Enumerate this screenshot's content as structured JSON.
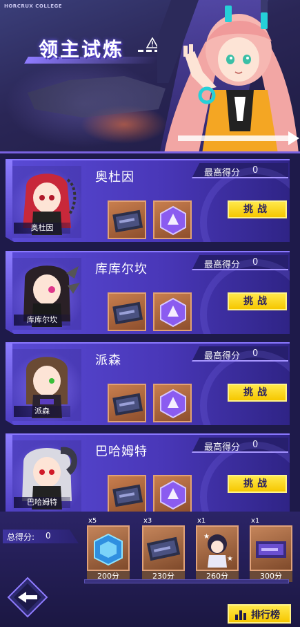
{
  "header": {
    "brand": "HORCRUX COLLEGE",
    "title": "领主试炼"
  },
  "labels": {
    "best_score": "最高得分",
    "challenge": "挑战"
  },
  "bosses": [
    {
      "name": "奥杜因",
      "portrait_tag": "奥杜因",
      "best_score": "0",
      "hair_color": "#c8283a"
    },
    {
      "name": "库库尔坎",
      "portrait_tag": "库库尔坎",
      "best_score": "0",
      "hair_color": "#2a2026"
    },
    {
      "name": "派森",
      "portrait_tag": "派森",
      "best_score": "0",
      "hair_color": "#6a4a34"
    },
    {
      "name": "巴哈姆特",
      "portrait_tag": "巴哈姆特",
      "best_score": "0",
      "hair_color": "#d9d9e2"
    }
  ],
  "rewards_per_boss": [
    "ticket-icon",
    "crystal-icon"
  ],
  "bottom": {
    "total_score_label": "总得分:",
    "total_score_value": "0",
    "milestones": [
      {
        "count": "x5",
        "points": "200分",
        "icon": "blue-cube-icon"
      },
      {
        "count": "x3",
        "points": "230分",
        "icon": "ticket-icon"
      },
      {
        "count": "x1",
        "points": "260分",
        "icon": "chibi-character-icon"
      },
      {
        "count": "x1",
        "points": "300分",
        "icon": "purple-ticket-icon"
      }
    ],
    "progress_fraction": 0,
    "rank_label": "排行榜"
  },
  "colors": {
    "accent_yellow": "#f6c700",
    "card_purple": "#4937b8",
    "reward_bronze": "#a9663d"
  }
}
